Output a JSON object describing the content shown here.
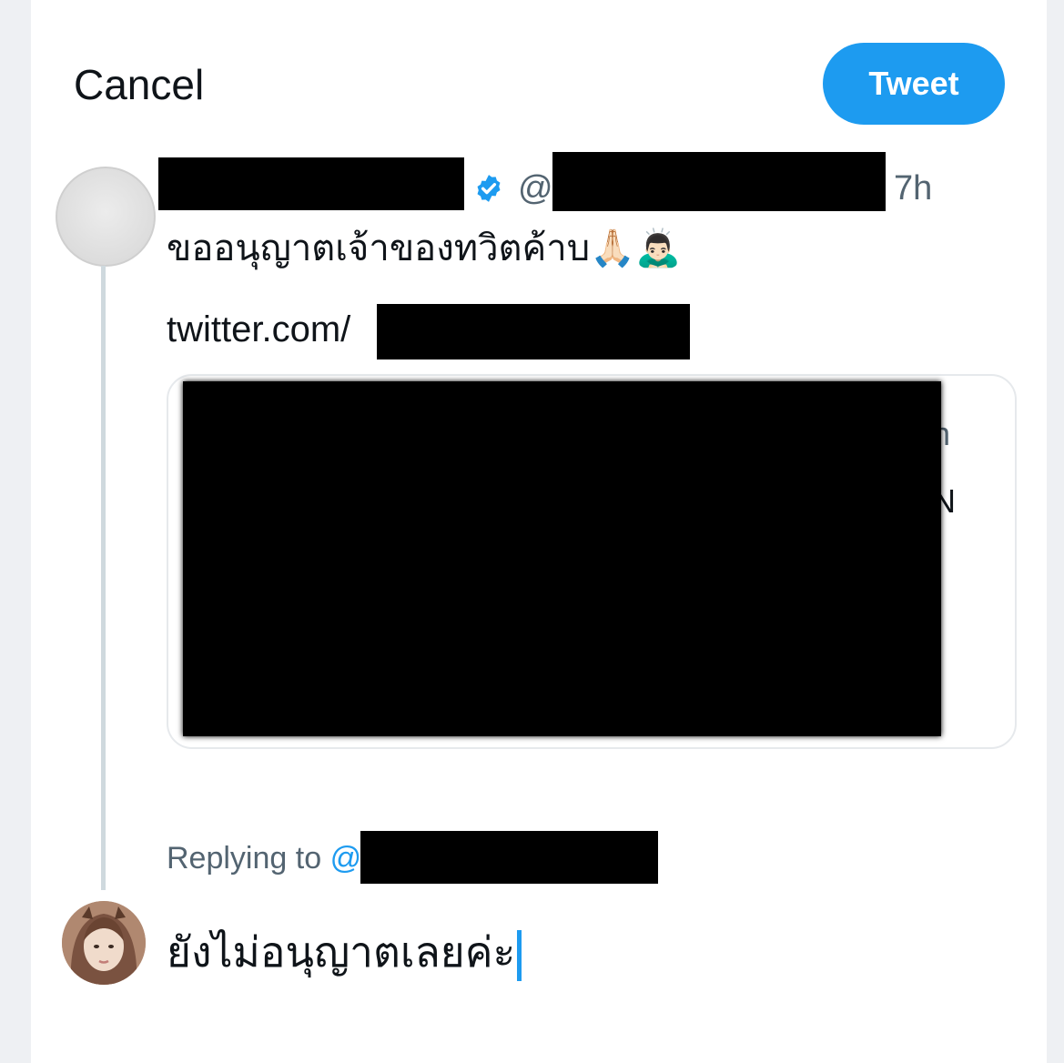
{
  "header": {
    "cancel_label": "Cancel",
    "tweet_label": "Tweet"
  },
  "original_tweet": {
    "at_symbol": "@",
    "time": "7h",
    "text": "ขออนุญาตเจ้าของทวิตค้าบ🙏🏻🙇🏻‍♂️",
    "link_prefix": "twitter.com/",
    "verified_icon": "verified-badge-icon",
    "card_peek_1": "h",
    "card_peek_2": "N"
  },
  "reply": {
    "replying_to_label": "Replying to",
    "at_symbol": "@",
    "text": "ยังไม่อนุญาตเลยค่ะ"
  },
  "colors": {
    "accent": "#1d9bf0",
    "text": "#0f1419",
    "muted": "#536471"
  }
}
